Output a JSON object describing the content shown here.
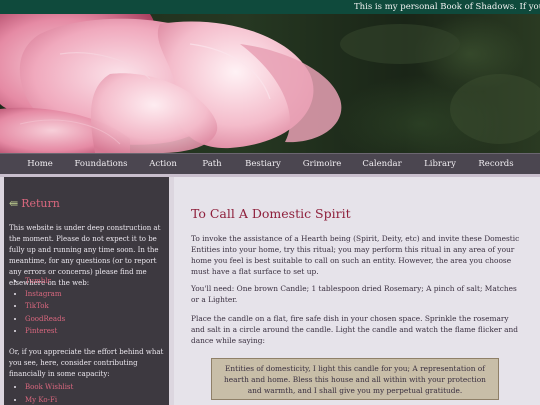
{
  "banner": {
    "marquee_text": "This is my personal Book of Shadows. If you find it i"
  },
  "nav": {
    "items": [
      {
        "label": "Home"
      },
      {
        "label": "Foundations"
      },
      {
        "label": "Action"
      },
      {
        "label": "Path"
      },
      {
        "label": "Bestiary"
      },
      {
        "label": "Grimoire"
      },
      {
        "label": "Calendar"
      },
      {
        "label": "Library"
      },
      {
        "label": "Records"
      }
    ]
  },
  "sidebar": {
    "return_label": "Return",
    "notice": "This website is under deep construction at the moment. Please do not expect it to be fully up and running any time soon. In the meantime, for any questions (or to report any errors or concerns) please find me elsewhere on the web:",
    "social_links": [
      "Tumblr",
      "Instagram",
      "TikTok",
      "GoodReads",
      "Pinterest"
    ],
    "support_text": "Or, if you appreciate the effort behind what you see, here, consider contributing financially in some capacity:",
    "support_links": [
      "Book Wishlist",
      "My Ko-Fi"
    ]
  },
  "main": {
    "title": "To Call A Domestic Spirit",
    "intro": "To invoke the assistance of a Hearth being (Spirit, Deity, etc) and invite these Domestic Entities into your home, try this ritual; you may perform this ritual in any area of your home you feel is best suitable to call on such an entity. However, the area you choose must have a flat surface to set up.",
    "needs": "You'll need: One brown Candle; 1 tablespoon dried Rosemary; A pinch of salt; Matches or a Lighter.",
    "steps": "Place the candle on a flat, fire safe dish in your chosen space. Sprinkle the rosemary and salt in a circle around the candle. Light the candle and watch the flame flicker and dance while saying:",
    "incantation": "Entities of domesticity, I light this candle for you; A representation of hearth and home. Bless this house and all within with your protection and warmth, and I shall give you my perpetual gratitude."
  },
  "colors": {
    "topbar": "#0f4a3c",
    "nav": "#4b4650",
    "sidebar": "#3d3940",
    "accent_link": "#d9677e",
    "title": "#8e1f3b",
    "quote_box": "#c8bea8"
  }
}
